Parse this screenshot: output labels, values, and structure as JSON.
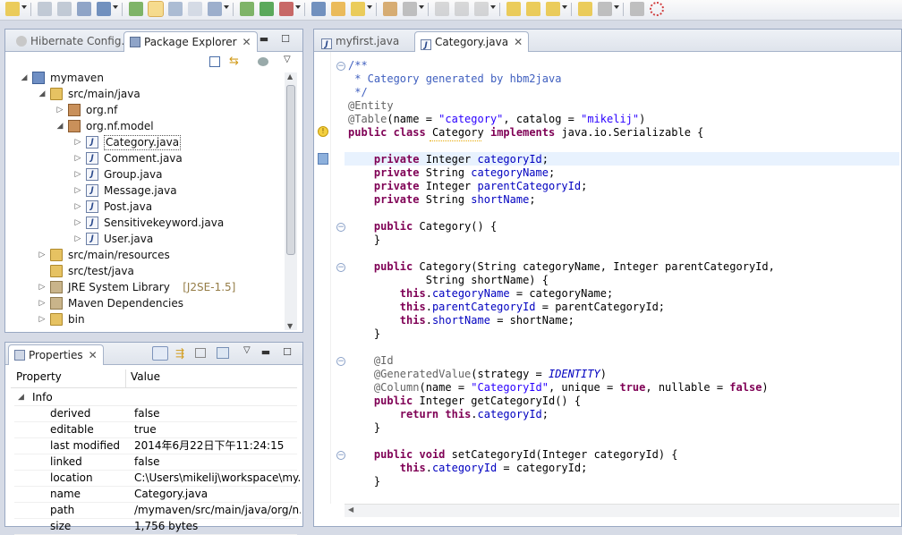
{
  "toolbar": {
    "icons": [
      "new-icon",
      "save-icon",
      "save-all-icon",
      "print-icon",
      "terminal-icon",
      "open-type-icon",
      "mark-occurrences-icon",
      "toggle-breadcrumb-icon",
      "block-selection-icon",
      "show-whitespace-icon",
      "debug-icon",
      "run-icon",
      "external-tools-icon",
      "search-icon",
      "open-folder-icon",
      "open-resource-icon",
      "task-icon",
      "annotation-nav-icon",
      "resume-icon",
      "suspend-icon",
      "terminate-icon",
      "step-into-icon",
      "step-over-icon",
      "step-return-icon",
      "back-icon",
      "forward-icon",
      "pin-icon",
      "perspective-icon"
    ]
  },
  "left_top": {
    "tabs": [
      {
        "label": "Hibernate Config..."
      },
      {
        "label": "Package Explorer"
      }
    ],
    "tree": [
      {
        "label": "mymaven",
        "depth": 0,
        "icon": "project",
        "expanded": true
      },
      {
        "label": "src/main/java",
        "depth": 1,
        "icon": "source-folder",
        "expanded": true
      },
      {
        "label": "org.nf",
        "depth": 2,
        "icon": "package",
        "expanded": false
      },
      {
        "label": "org.nf.model",
        "depth": 2,
        "icon": "package",
        "expanded": true
      },
      {
        "label": "Category.java",
        "depth": 3,
        "icon": "java",
        "expanded": false,
        "selected": true
      },
      {
        "label": "Comment.java",
        "depth": 3,
        "icon": "java",
        "expanded": false
      },
      {
        "label": "Group.java",
        "depth": 3,
        "icon": "java",
        "expanded": false
      },
      {
        "label": "Message.java",
        "depth": 3,
        "icon": "java",
        "expanded": false
      },
      {
        "label": "Post.java",
        "depth": 3,
        "icon": "java",
        "expanded": false
      },
      {
        "label": "Sensitivekeyword.java",
        "depth": 3,
        "icon": "java",
        "expanded": false
      },
      {
        "label": "User.java",
        "depth": 3,
        "icon": "java",
        "expanded": false
      },
      {
        "label": "src/main/resources",
        "depth": 1,
        "icon": "source-folder",
        "expanded": false
      },
      {
        "label": "src/test/java",
        "depth": 1,
        "icon": "source-folder",
        "expanded": null
      },
      {
        "label": "JRE System Library",
        "suffix": "[J2SE-1.5]",
        "depth": 1,
        "icon": "library",
        "expanded": false
      },
      {
        "label": "Maven Dependencies",
        "depth": 1,
        "icon": "library",
        "expanded": false
      },
      {
        "label": "bin",
        "depth": 1,
        "icon": "folder",
        "expanded": false
      }
    ]
  },
  "properties": {
    "tab_label": "Properties",
    "header_property": "Property",
    "header_value": "Value",
    "group_label": "Info",
    "rows": [
      {
        "key": "derived",
        "value": "false"
      },
      {
        "key": "editable",
        "value": "true"
      },
      {
        "key": "last modified",
        "value": "2014年6月22日下午11:24:15"
      },
      {
        "key": "linked",
        "value": "false"
      },
      {
        "key": "location",
        "value": "C:\\Users\\mikelij\\workspace\\my..."
      },
      {
        "key": "name",
        "value": "Category.java"
      },
      {
        "key": "path",
        "value": "/mymaven/src/main/java/org/n..."
      },
      {
        "key": "size",
        "value": "1,756  bytes"
      }
    ]
  },
  "editor": {
    "tabs": [
      {
        "label": "myfirst.java"
      },
      {
        "label": "Category.java"
      }
    ]
  }
}
